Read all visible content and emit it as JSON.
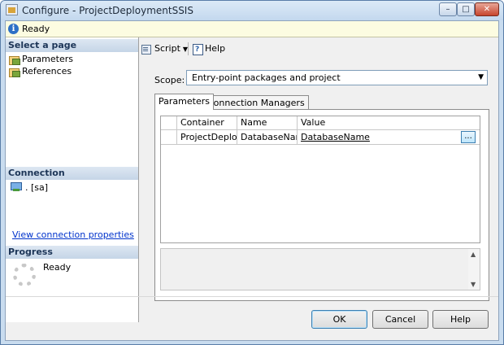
{
  "window": {
    "title": "Configure - ProjectDeploymentSSIS",
    "minimize": "–",
    "maximize": "□",
    "close": "✕"
  },
  "status": {
    "text": "Ready",
    "icon": "info-icon"
  },
  "left": {
    "select_page_header": "Select a page",
    "pages": [
      {
        "label": "Parameters",
        "icon": "page-icon"
      },
      {
        "label": "References",
        "icon": "page-icon"
      }
    ],
    "connection_header": "Connection",
    "connection_text": ". [sa]",
    "connection_link": "View connection properties",
    "progress_header": "Progress",
    "progress_text": "Ready"
  },
  "toolbar": {
    "script_label": "Script",
    "help_label": "Help"
  },
  "scope": {
    "label": "Scope:",
    "value": "Entry-point packages and project"
  },
  "tabs": [
    {
      "label": "Parameters",
      "active": true
    },
    {
      "label": "Connection Managers",
      "active": false
    }
  ],
  "grid": {
    "columns": [
      "",
      "Container",
      "Name",
      "Value"
    ],
    "rows": [
      {
        "container": "ProjectDeplo...",
        "name": "DatabaseName",
        "value": "DatabaseName",
        "button": "..."
      }
    ]
  },
  "buttons": {
    "ok": "OK",
    "cancel": "Cancel",
    "help": "Help"
  }
}
